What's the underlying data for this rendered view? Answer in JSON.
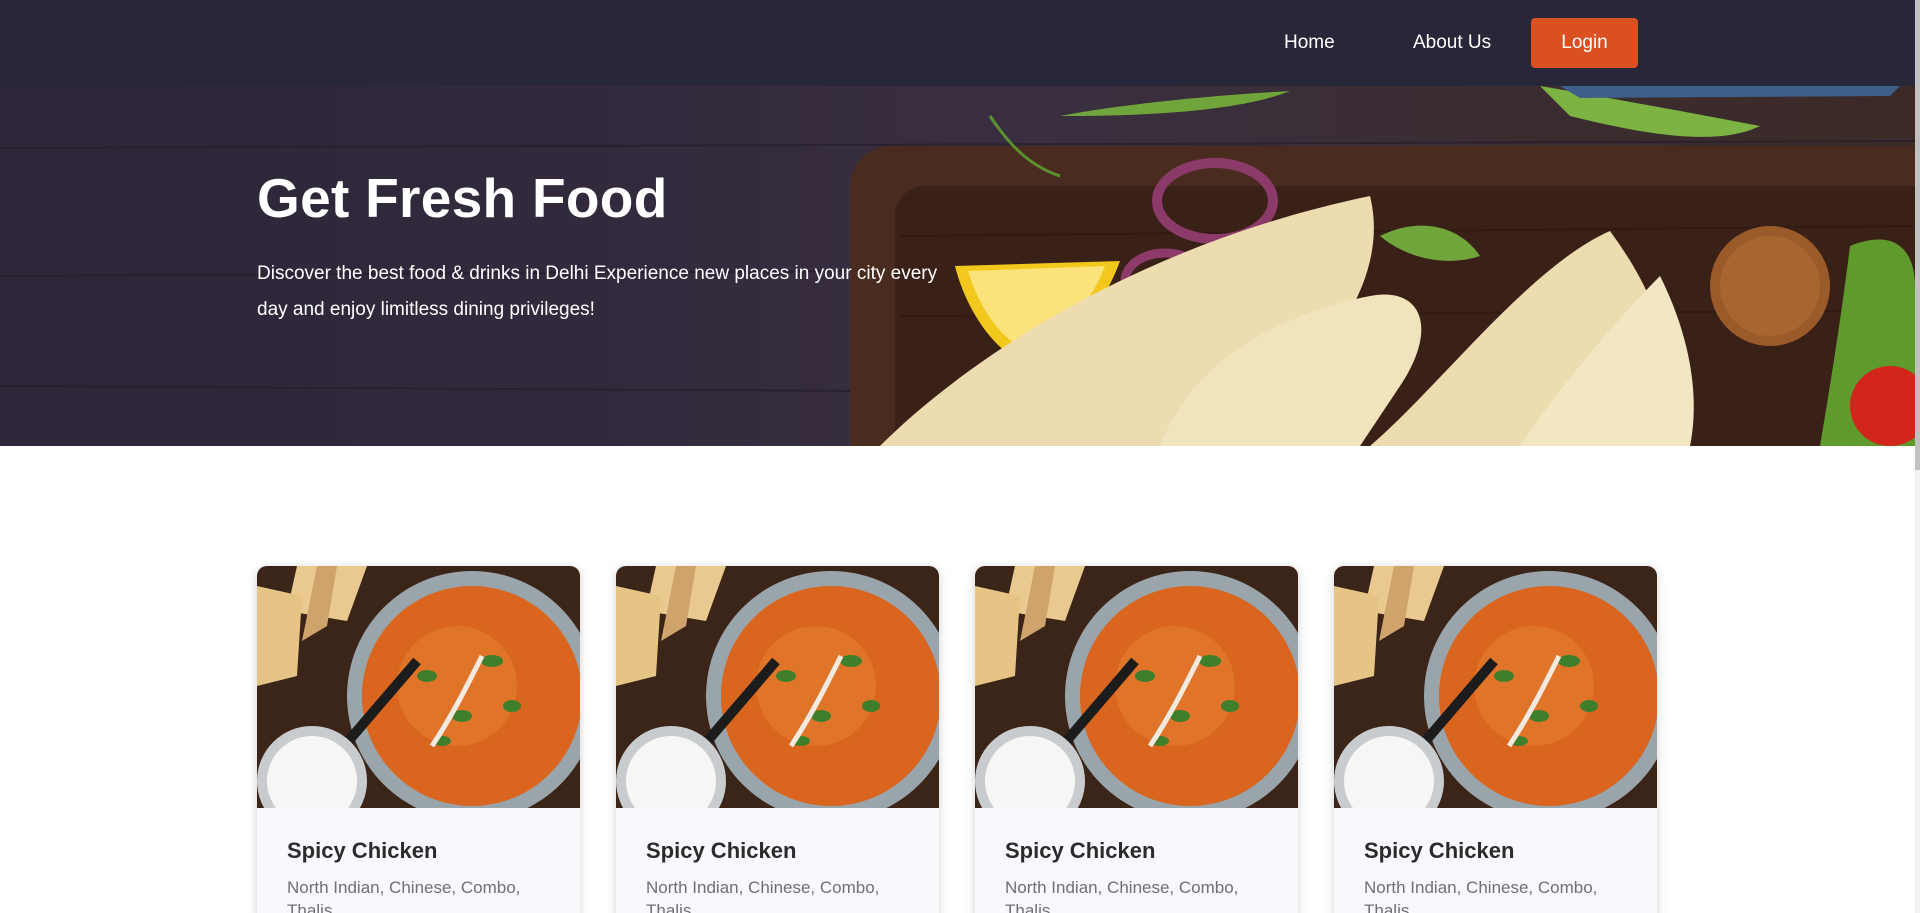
{
  "nav": {
    "home_label": "Home",
    "about_label": "About Us",
    "login_label": "Login",
    "background_color": "#272739",
    "login_color": "#da5020"
  },
  "hero": {
    "title": "Get Fresh Food",
    "description_line1": "Discover the best food & drinks in Delhi Experience new places in your city every",
    "description_line2": "day and enjoy limitless dining privileges!"
  },
  "cards": [
    {
      "title": "Spicy Chicken",
      "cuisines": "North Indian, Chinese, Combo, Thalis"
    },
    {
      "title": "Spicy Chicken",
      "cuisines": "North Indian, Chinese, Combo, Thalis"
    },
    {
      "title": "Spicy Chicken",
      "cuisines": "North Indian, Chinese, Combo, Thalis"
    },
    {
      "title": "Spicy Chicken",
      "cuisines": "North Indian, Chinese, Combo, Thalis"
    }
  ]
}
